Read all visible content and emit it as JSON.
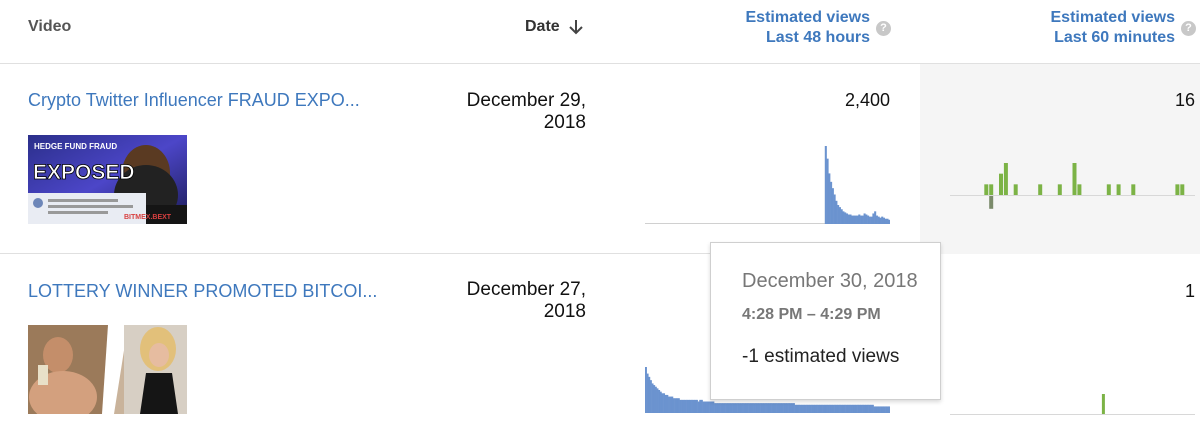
{
  "header": {
    "video_label": "Video",
    "date_label": "Date",
    "views48_line1": "Estimated views",
    "views48_line2": "Last 48 hours",
    "views60_line1": "Estimated views",
    "views60_line2": "Last 60 minutes",
    "help_glyph": "?"
  },
  "rows": [
    {
      "title": "Crypto Twitter Influencer FRAUD EXPO...",
      "date_line1": "December 29,",
      "date_line2": "2018",
      "views_48h": "2,400",
      "views_60m": "16",
      "thumbnail_text": {
        "top": "HEDGE FUND FRAUD",
        "main": "EXPOSED",
        "brand": "BITMEX.BEXT"
      },
      "spark_48h": [
        0,
        0,
        0,
        0,
        0,
        0,
        0,
        0,
        0,
        0,
        0,
        0,
        0,
        0,
        0,
        0,
        0,
        0,
        0,
        0,
        0,
        0,
        0,
        0,
        0,
        0,
        0,
        0,
        0,
        0,
        0,
        0,
        0,
        0,
        0,
        0,
        0,
        0,
        0,
        0,
        0,
        0,
        0,
        0,
        0,
        0,
        0,
        0,
        0,
        0,
        0,
        0,
        0,
        0,
        0,
        0,
        0,
        0,
        0,
        0,
        0,
        0,
        0,
        0,
        0,
        0,
        0,
        0,
        0,
        0,
        0,
        0,
        0,
        0,
        0,
        0,
        0,
        0,
        0,
        0,
        0,
        0,
        0,
        0,
        0,
        0,
        0,
        0,
        0,
        0,
        0,
        0,
        0,
        0,
        0,
        0,
        0,
        0,
        0,
        0,
        0,
        0,
        74,
        62,
        48,
        40,
        34,
        28,
        22,
        18,
        16,
        14,
        12,
        11,
        10,
        9,
        9,
        8,
        8,
        8,
        8,
        9,
        8,
        8,
        10,
        9,
        8,
        7,
        7,
        10,
        12,
        8,
        7,
        6,
        7,
        6,
        5,
        5,
        4
      ],
      "spark_60m_pos": [
        0,
        0,
        0,
        0,
        0,
        0,
        0,
        1,
        1,
        0,
        2,
        3,
        0,
        1,
        0,
        0,
        0,
        0,
        1,
        0,
        0,
        0,
        1,
        0,
        0,
        3,
        1,
        0,
        0,
        0,
        0,
        0,
        1,
        0,
        1,
        0,
        0,
        1,
        0,
        0,
        0,
        0,
        0,
        0,
        0,
        0,
        1,
        1,
        0,
        0
      ],
      "spark_60m_neg": [
        0,
        0,
        0,
        0,
        0,
        0,
        0,
        0,
        2,
        0,
        0,
        0,
        0,
        0,
        0,
        0,
        0,
        0,
        0,
        0,
        0,
        0,
        0,
        0,
        0,
        0,
        0,
        0,
        0,
        0,
        0,
        0,
        0,
        0,
        0,
        0,
        0,
        0,
        0,
        0,
        0,
        0,
        0,
        0,
        0,
        0,
        0,
        0,
        0,
        0
      ]
    },
    {
      "title": "LOTTERY WINNER PROMOTED BITCOI...",
      "date_line1": "December 27,",
      "date_line2": "2018",
      "views_48h": "",
      "views_60m": "1",
      "spark_48h": [
        28,
        24,
        22,
        20,
        18,
        17,
        16,
        15,
        14,
        13,
        12,
        12,
        11,
        11,
        10,
        10,
        10,
        9,
        9,
        9,
        9,
        8,
        8,
        8,
        8,
        8,
        8,
        8,
        8,
        8,
        8,
        8,
        7,
        8,
        8,
        7,
        7,
        7,
        7,
        7,
        7,
        7,
        6,
        6,
        6,
        6,
        6,
        6,
        6,
        6,
        6,
        6,
        6,
        6,
        6,
        6,
        6,
        6,
        6,
        6,
        6,
        6,
        6,
        6,
        6,
        6,
        6,
        6,
        6,
        6,
        6,
        6,
        6,
        6,
        6,
        6,
        6,
        6,
        6,
        6,
        6,
        6,
        6,
        6,
        6,
        6,
        6,
        6,
        6,
        6,
        6,
        5,
        5,
        5,
        5,
        5,
        5,
        5,
        5,
        5,
        5,
        5,
        5,
        5,
        5,
        5,
        5,
        5,
        5,
        5,
        5,
        5,
        5,
        5,
        5,
        5,
        5,
        5,
        5,
        5,
        5,
        5,
        5,
        5,
        5,
        5,
        5,
        5,
        5,
        5,
        5,
        5,
        5,
        5,
        5,
        5,
        5,
        5,
        5,
        4,
        4,
        4,
        4,
        4,
        4,
        4,
        4,
        4,
        4
      ],
      "spark_60m_pos": [
        0,
        0,
        0,
        0,
        0,
        0,
        0,
        0,
        0,
        0,
        0,
        0,
        0,
        0,
        0,
        0,
        0,
        0,
        0,
        0,
        0,
        0,
        0,
        0,
        0,
        0,
        0,
        0,
        0,
        0,
        0,
        0,
        0,
        0,
        0,
        0,
        0,
        0,
        0,
        0,
        0,
        0,
        0,
        0,
        0,
        0,
        0,
        0,
        0,
        0
      ],
      "spark_60m_neg": [
        0,
        0,
        0,
        0,
        0,
        0,
        0,
        0,
        0,
        0,
        0,
        0,
        0,
        0,
        0,
        0,
        0,
        0,
        0,
        0,
        0,
        0,
        0,
        0,
        0,
        0,
        0,
        0,
        0,
        0,
        0,
        0,
        0,
        0,
        0,
        0,
        0,
        0,
        0,
        0,
        0,
        0,
        0,
        0,
        0,
        0,
        0,
        0,
        0,
        0
      ],
      "spark_60m_single": 1
    }
  ],
  "tooltip": {
    "date": "December 30, 2018",
    "time": "4:28 PM – 4:29 PM",
    "value": "-1 estimated views"
  },
  "colors": {
    "link": "#3e78bd",
    "bar_48h": "#6b93cf",
    "bar_60m": "#7cb346"
  }
}
